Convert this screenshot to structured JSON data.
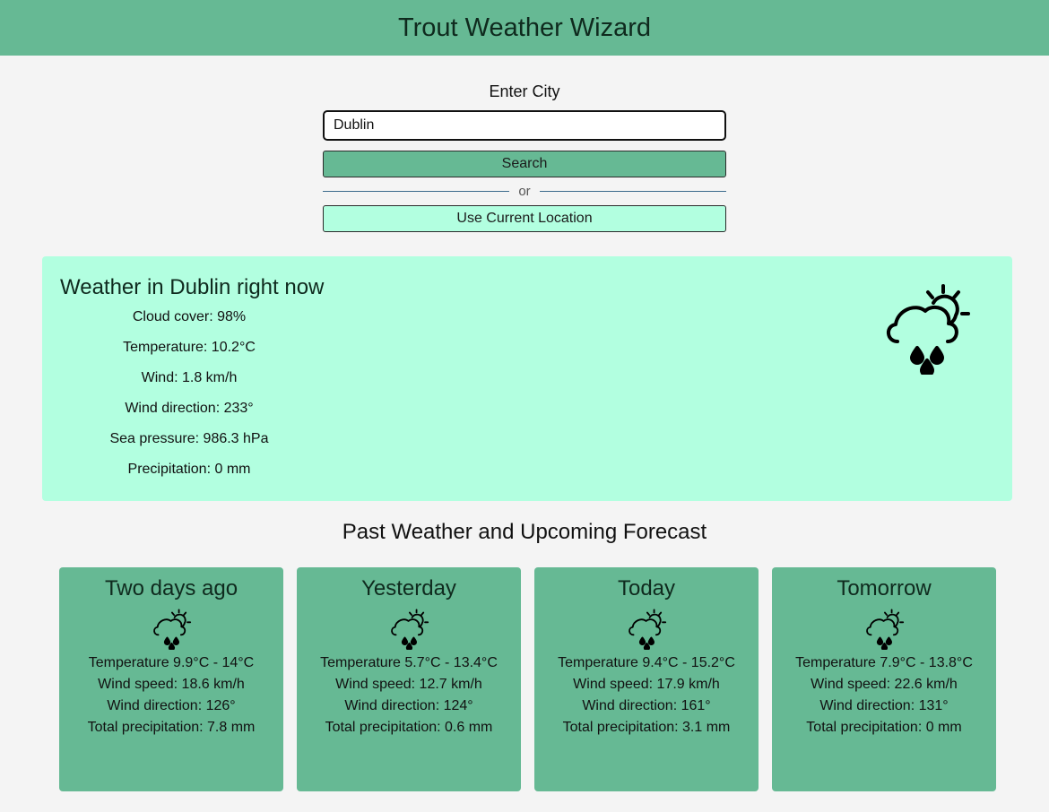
{
  "header": {
    "title": "Trout Weather Wizard"
  },
  "search": {
    "label": "Enter City",
    "value": "Dublin",
    "button_label": "Search",
    "divider_text": "or",
    "location_button_label": "Use Current Location"
  },
  "current": {
    "title": "Weather in Dublin right now",
    "icon": "cloud-sun-rain-icon",
    "items": [
      "Cloud cover: 98%",
      "Temperature: 10.2°C",
      "Wind: 1.8 km/h",
      "Wind direction: 233°",
      "Sea pressure: 986.3 hPa",
      "Precipitation: 0 mm"
    ]
  },
  "forecast": {
    "heading": "Past Weather and Upcoming Forecast",
    "days": [
      {
        "title": "Two days ago",
        "icon": "cloud-sun-rain-icon",
        "temperature": "Temperature 9.9°C - 14°C",
        "wind_speed": "Wind speed: 18.6 km/h",
        "wind_direction": "Wind direction: 126°",
        "precipitation": "Total precipitation: 7.8 mm"
      },
      {
        "title": "Yesterday",
        "icon": "cloud-sun-rain-icon",
        "temperature": "Temperature 5.7°C - 13.4°C",
        "wind_speed": "Wind speed: 12.7 km/h",
        "wind_direction": "Wind direction: 124°",
        "precipitation": "Total precipitation: 0.6 mm"
      },
      {
        "title": "Today",
        "icon": "cloud-sun-rain-icon",
        "temperature": "Temperature 9.4°C - 15.2°C",
        "wind_speed": "Wind speed: 17.9 km/h",
        "wind_direction": "Wind direction: 161°",
        "precipitation": "Total precipitation: 3.1 mm"
      },
      {
        "title": "Tomorrow",
        "icon": "cloud-sun-rain-icon",
        "temperature": "Temperature 7.9°C - 13.8°C",
        "wind_speed": "Wind speed: 22.6 km/h",
        "wind_direction": "Wind direction: 131°",
        "precipitation": "Total precipitation: 0 mm"
      }
    ]
  },
  "colors": {
    "header_bg": "#66b994",
    "current_card_bg": "#b2ffe0",
    "forecast_card_bg": "#66b994",
    "page_bg": "#f4f4f4"
  }
}
